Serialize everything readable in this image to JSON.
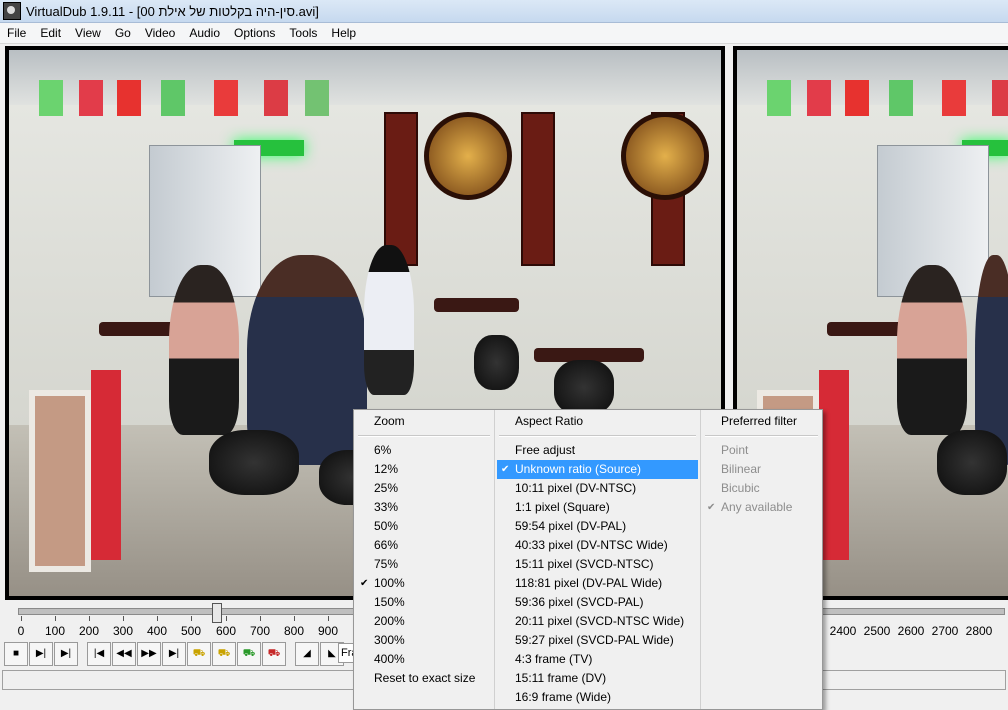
{
  "window": {
    "title": "VirtualDub 1.9.11 - [00 סין-היה בקלטות של אילת.avi]"
  },
  "menubar": [
    "File",
    "Edit",
    "View",
    "Go",
    "Video",
    "Audio",
    "Options",
    "Tools",
    "Help"
  ],
  "timeline": {
    "position_frame": 574,
    "ticks_left": [
      "0",
      "100",
      "200",
      "300",
      "400",
      "500",
      "600",
      "700",
      "800",
      "900"
    ],
    "ticks_right": [
      "2400",
      "2500",
      "2600",
      "2700",
      "2800"
    ]
  },
  "toolbar": {
    "frame_label": "Fra"
  },
  "context_menu": {
    "zoom": {
      "header": "Zoom",
      "items": [
        "6%",
        "12%",
        "25%",
        "33%",
        "50%",
        "66%",
        "75%",
        "100%",
        "150%",
        "200%",
        "300%",
        "400%",
        "Reset to exact size"
      ],
      "checked": "100%"
    },
    "aspect": {
      "header": "Aspect Ratio",
      "items": [
        "Free adjust",
        "Unknown ratio (Source)",
        "10:11 pixel (DV-NTSC)",
        "1:1 pixel (Square)",
        "59:54 pixel (DV-PAL)",
        "40:33 pixel (DV-NTSC Wide)",
        "15:11 pixel (SVCD-NTSC)",
        "118:81 pixel (DV-PAL Wide)",
        "59:36 pixel (SVCD-PAL)",
        "20:11 pixel (SVCD-NTSC Wide)",
        "59:27 pixel (SVCD-PAL Wide)",
        "4:3 frame (TV)",
        "15:11 frame (DV)",
        "16:9 frame (Wide)"
      ],
      "checked": "Unknown ratio (Source)"
    },
    "filter": {
      "header": "Preferred filter",
      "items": [
        "Point",
        "Bilinear",
        "Bicubic",
        "Any available"
      ],
      "checked": "Any available"
    }
  }
}
